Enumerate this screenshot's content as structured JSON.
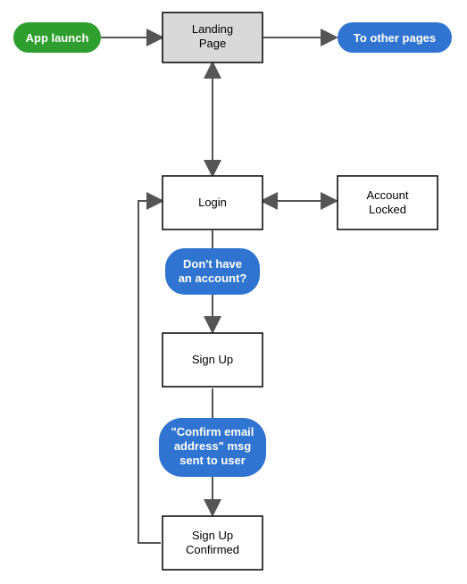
{
  "nodes": {
    "app_launch": "App launch",
    "landing_page_l1": "Landing",
    "landing_page_l2": "Page",
    "to_other_pages": "To other pages",
    "login": "Login",
    "account_locked_l1": "Account",
    "account_locked_l2": "Locked",
    "no_account_l1": "Don't have",
    "no_account_l2": "an account?",
    "sign_up": "Sign Up",
    "confirm_l1": "\"Confirm email",
    "confirm_l2": "address\" msg",
    "confirm_l3": "sent to user",
    "sign_up_confirmed_l1": "Sign Up",
    "sign_up_confirmed_l2": "Confirmed"
  },
  "colors": {
    "green": "#2e9e2e",
    "blue": "#2f74d0",
    "arrow": "#555555",
    "shaded": "#d9d9d9"
  },
  "diagram": {
    "type": "flowchart",
    "flow": [
      "App launch → Landing Page",
      "Landing Page → To other pages",
      "Landing Page ↔ Login",
      "Login ↔ Account Locked",
      "Login → (Don't have an account?) → Sign Up",
      "Sign Up → (\"Confirm email address\" msg sent to user) → Sign Up Confirmed",
      "Sign Up Confirmed → Login"
    ]
  }
}
